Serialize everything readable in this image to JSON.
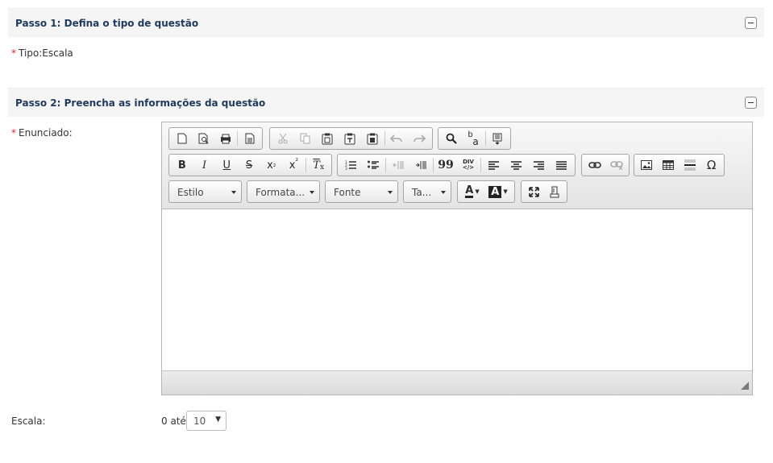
{
  "step1": {
    "title": "Passo 1: Defina o tipo de questão"
  },
  "tipo": {
    "required_mark": "*",
    "label": "Tipo:Escala"
  },
  "step2": {
    "title": "Passo 2: Preencha as informações da questão"
  },
  "enunciado": {
    "required_mark": "*",
    "label": "Enunciado:"
  },
  "toolbar": {
    "bold": "B",
    "italic": "I",
    "underline": "U",
    "strike": "S",
    "subscript_base": "x",
    "subscript_mark": "₂",
    "superscript_base": "x",
    "superscript_mark": "²",
    "remove_format": "T",
    "remove_format_mark": "x",
    "blockquote": "99",
    "div_top": "DIV",
    "div_bottom": "</>",
    "special_char": "Ω",
    "find_replace_top": "b",
    "find_replace_bottom": "a",
    "combo_style": "Estilo",
    "combo_format": "Formata...",
    "combo_font": "Fonte",
    "combo_size": "Ta...",
    "text_color": "A",
    "bg_color": "A"
  },
  "escala": {
    "label": "Escala:",
    "range_prefix": "0 até",
    "selected": "10"
  },
  "icons": [
    "new-page-icon",
    "preview-icon",
    "print-icon",
    "templates-icon",
    "cut-icon",
    "copy-icon",
    "paste-icon",
    "paste-text-icon",
    "paste-word-icon",
    "undo-icon",
    "redo-icon",
    "find-icon",
    "replace-icon",
    "select-all-icon",
    "numbered-list-icon",
    "bulleted-list-icon",
    "outdent-icon",
    "indent-icon",
    "align-left-icon",
    "align-center-icon",
    "align-right-icon",
    "justify-icon",
    "link-icon",
    "unlink-icon",
    "image-icon",
    "table-icon",
    "horizontal-line-icon",
    "maximize-icon",
    "show-blocks-icon",
    "resize-grip-icon",
    "collapse-icon"
  ]
}
